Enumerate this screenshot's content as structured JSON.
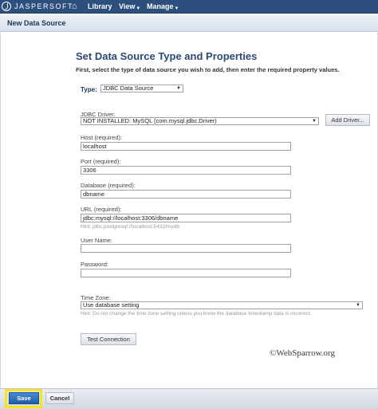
{
  "app": {
    "logo_text": "JASPERSOFT"
  },
  "nav": {
    "home_icon": "home-icon",
    "items": [
      {
        "label": "Library",
        "has_menu": false
      },
      {
        "label": "View",
        "has_menu": true
      },
      {
        "label": "Manage",
        "has_menu": true
      }
    ]
  },
  "subheader": {
    "title": "New Data Source"
  },
  "page": {
    "title": "Set Data Source Type and Properties",
    "instructions": "First, select the type of data source you wish to add, then enter the required property values."
  },
  "type": {
    "label": "Type:",
    "value": "JDBC Data Source"
  },
  "jdbc_driver": {
    "label": "JDBC Driver:",
    "value": "NOT INSTALLED: MySQL (com.mysql.jdbc.Driver)",
    "add_button": "Add Driver..."
  },
  "fields": {
    "host": {
      "label": "Host (required):",
      "value": "localhost"
    },
    "port": {
      "label": "Port (required):",
      "value": "3306"
    },
    "database": {
      "label": "Database (required):",
      "value": "dbname"
    },
    "url": {
      "label": "URL (required):",
      "value": "jdbc:mysql://localhost:3306/dbname",
      "hint": "Hint: jdbc:postgresql://localhost:5432/mydb"
    },
    "username": {
      "label": "User Name:",
      "value": ""
    },
    "password": {
      "label": "Password:",
      "value": ""
    }
  },
  "timezone": {
    "label": "Time Zone:",
    "value": "Use database setting",
    "hint": "Hint: Do not change the time zone setting unless you know the database timestamp data is incorrect."
  },
  "test_button": "Test Connection",
  "watermark": "©WebSparrow.org",
  "footer": {
    "save": "Save",
    "cancel": "Cancel"
  },
  "colors": {
    "topbar": "#2d4f7d",
    "title": "#2a4a73",
    "save_highlight": "#f7e51a",
    "save_button": "#1f5fa8"
  }
}
